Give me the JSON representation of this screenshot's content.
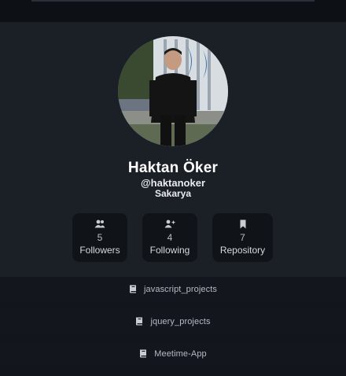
{
  "profile": {
    "name": "Haktan Öker",
    "handle": "@haktanoker",
    "location": "Sakarya"
  },
  "stats": [
    {
      "icon": "followers-icon",
      "value": "5",
      "label": "Followers"
    },
    {
      "icon": "following-icon",
      "value": "4",
      "label": "Following"
    },
    {
      "icon": "bookmark-icon",
      "value": "7",
      "label": "Repository"
    }
  ],
  "repos": [
    {
      "icon": "book-icon",
      "name": "javascript_projects"
    },
    {
      "icon": "book-icon",
      "name": "jquery_projects"
    },
    {
      "icon": "book-icon",
      "name": "Meetime-App"
    }
  ],
  "colors": {
    "page_bg": "#12161c",
    "card_bg": "#1b1f26",
    "stat_bg": "#101419",
    "repo_bg": "#13171d",
    "text_primary": "#ffffff"
  }
}
